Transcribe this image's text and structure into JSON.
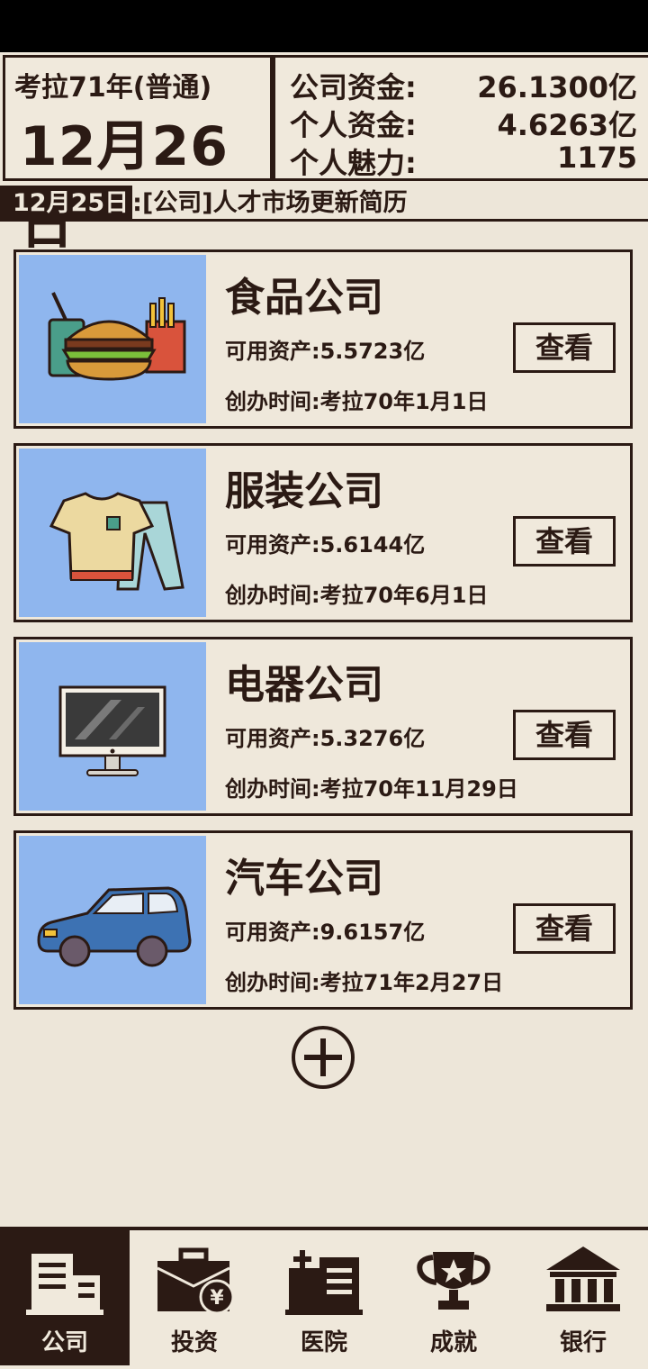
{
  "header": {
    "era": "考拉71年(普通)",
    "date": "12月26日",
    "stats": [
      {
        "label": "公司资金:",
        "value": "26.1300亿"
      },
      {
        "label": "个人资金:",
        "value": "4.6263亿"
      },
      {
        "label": "个人魅力:",
        "value": "1175"
      }
    ]
  },
  "news": {
    "date": "12月25日",
    "text": ":[公司]人才市场更新简历"
  },
  "companies": [
    {
      "name": "食品公司",
      "asset": "可用资产:5.5723亿",
      "founded": "创办时间:考拉70年1月1日",
      "button": "查看",
      "icon": "food-icon"
    },
    {
      "name": "服装公司",
      "asset": "可用资产:5.6144亿",
      "founded": "创办时间:考拉70年6月1日",
      "button": "查看",
      "icon": "clothing-icon"
    },
    {
      "name": "电器公司",
      "asset": "可用资产:5.3276亿",
      "founded": "创办时间:考拉70年11月29日",
      "button": "查看",
      "icon": "monitor-icon"
    },
    {
      "name": "汽车公司",
      "asset": "可用资产:9.6157亿",
      "founded": "创办时间:考拉71年2月27日",
      "button": "查看",
      "icon": "car-icon"
    }
  ],
  "add_button_icon": "plus-circle-icon",
  "nav": [
    {
      "label": "公司",
      "icon": "building-icon",
      "active": true
    },
    {
      "label": "投资",
      "icon": "briefcase-yen-icon",
      "active": false
    },
    {
      "label": "医院",
      "icon": "hospital-icon",
      "active": false
    },
    {
      "label": "成就",
      "icon": "trophy-icon",
      "active": false
    },
    {
      "label": "银行",
      "icon": "bank-icon",
      "active": false
    }
  ],
  "colors": {
    "background": "#ede6d9",
    "ink": "#2b1a14",
    "card_image_bg": "#8fb6ee"
  }
}
